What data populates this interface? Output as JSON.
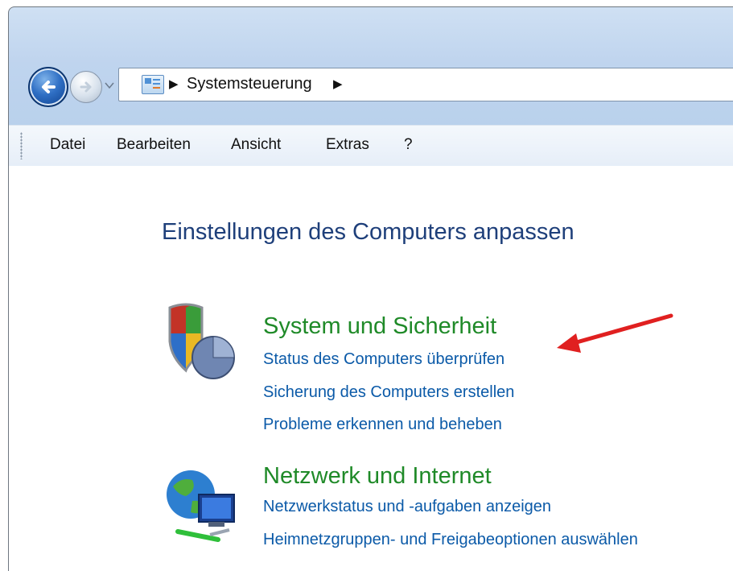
{
  "address": {
    "crumbs": [
      "Systemsteuerung"
    ],
    "separator": "▶"
  },
  "menu": {
    "items": [
      "Datei",
      "Bearbeiten",
      "Ansicht",
      "Extras",
      "?"
    ]
  },
  "page": {
    "title": "Einstellungen des Computers anpassen"
  },
  "categories": [
    {
      "title": "System und Sicherheit",
      "icon": "security-shield-icon",
      "links": [
        "Status des Computers überprüfen",
        "Sicherung des Computers erstellen",
        "Probleme erkennen und beheben"
      ]
    },
    {
      "title": "Netzwerk und Internet",
      "icon": "network-globe-icon",
      "links": [
        "Netzwerkstatus und -aufgaben anzeigen",
        "Heimnetzgruppen- und Freigabeoptionen auswählen"
      ]
    }
  ],
  "annotation": {
    "arrow_color": "#e02020",
    "target": "Status des Computers überprüfen"
  },
  "colors": {
    "category_title": "#1f8a28",
    "link": "#0b5aa8",
    "page_title": "#1e3f7a"
  }
}
